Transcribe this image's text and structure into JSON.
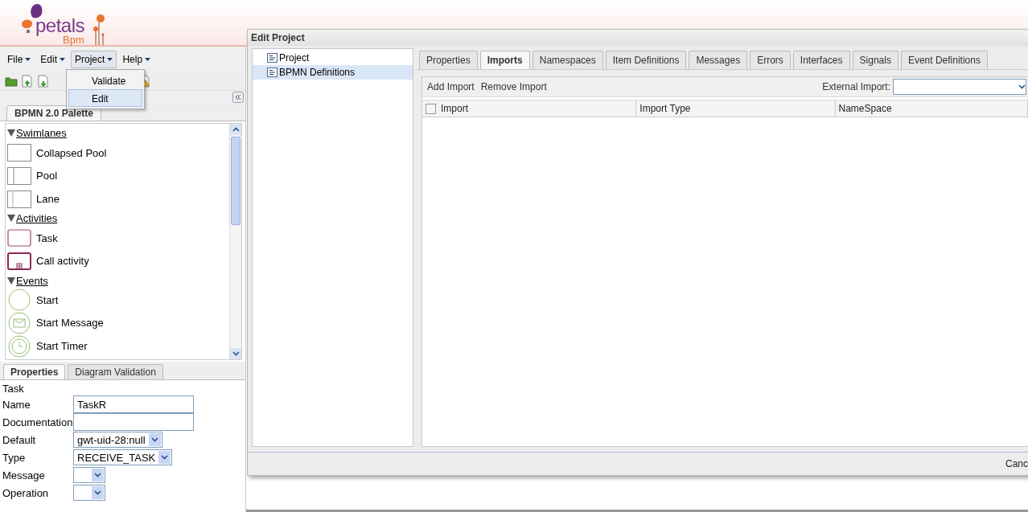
{
  "logo": {
    "name": "petals",
    "sub": "Bpm"
  },
  "menu": [
    {
      "label": "File",
      "open": false
    },
    {
      "label": "Edit",
      "open": false
    },
    {
      "label": "Project",
      "open": true
    },
    {
      "label": "Help",
      "open": false
    }
  ],
  "project_menu": [
    {
      "label": "Validate",
      "selected": false
    },
    {
      "label": "Edit",
      "selected": true
    }
  ],
  "palette": {
    "tab": "BPMN 2.0 Palette",
    "sections": [
      {
        "title": "Swimlanes",
        "expanded": true,
        "items": [
          {
            "label": "Collapsed Pool",
            "kind": "collapsed-pool"
          },
          {
            "label": "Pool",
            "kind": "pool"
          },
          {
            "label": "Lane",
            "kind": "lane"
          }
        ]
      },
      {
        "title": "Activities",
        "expanded": true,
        "items": [
          {
            "label": "Task",
            "kind": "task"
          },
          {
            "label": "Call activity",
            "kind": "call-activity"
          }
        ]
      },
      {
        "title": "Events",
        "expanded": true,
        "items": [
          {
            "label": "Start",
            "kind": "start"
          },
          {
            "label": "Start Message",
            "kind": "start-message"
          },
          {
            "label": "Start Timer",
            "kind": "start-timer"
          }
        ]
      }
    ]
  },
  "bottom_tabs": [
    {
      "label": "Properties",
      "selected": true
    },
    {
      "label": "Diagram Validation",
      "selected": false
    }
  ],
  "properties": {
    "heading": "Task",
    "fields": [
      {
        "label": "Name",
        "kind": "text",
        "value": "TaskR"
      },
      {
        "label": "Documentation",
        "kind": "text"
      },
      {
        "label": "Default",
        "kind": "select",
        "value": "gwt-uid-28:null"
      },
      {
        "label": "Type",
        "kind": "select",
        "value": "RECEIVE_TASK"
      },
      {
        "label": "Message",
        "kind": "select"
      },
      {
        "label": "Operation",
        "kind": "select"
      }
    ]
  },
  "dialog": {
    "title": "Edit Project",
    "tree": [
      {
        "label": "Project",
        "selected": false
      },
      {
        "label": "BPMN Definitions",
        "selected": true
      }
    ],
    "tabs": [
      {
        "label": "Properties",
        "selected": false
      },
      {
        "label": "Imports",
        "selected": true
      },
      {
        "label": "Namespaces",
        "selected": false
      },
      {
        "label": "Item Definitions",
        "selected": false
      },
      {
        "label": "Messages",
        "selected": false
      },
      {
        "label": "Errors",
        "selected": false
      },
      {
        "label": "Interfaces",
        "selected": false
      },
      {
        "label": "Signals",
        "selected": false
      },
      {
        "label": "Event Definitions",
        "selected": false
      }
    ],
    "actions": [
      "Add Import",
      "Remove Import"
    ],
    "external_import": {
      "label": "External Import:"
    },
    "table": {
      "select_all_checked": false,
      "columns": [
        "Import",
        "Import Type",
        "NameSpace"
      ]
    },
    "footer_button": "Canc"
  }
}
